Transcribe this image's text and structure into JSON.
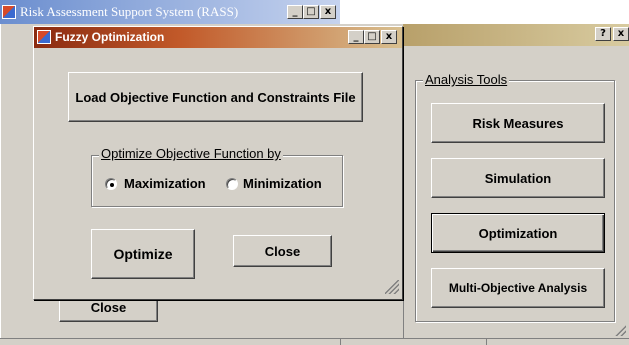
{
  "rass_window": {
    "title": "Risk Assessment Support System (RASS)",
    "minimize_glyph": "_",
    "maximize_glyph": "□",
    "close_glyph": "x",
    "help_glyph": "?",
    "analysis_tools": {
      "label": "Analysis Tools",
      "buttons": [
        "Risk Measures",
        "Simulation",
        "Optimization",
        "Multi-Objective Analysis"
      ]
    },
    "close_button": "Close"
  },
  "fuzzy_dialog": {
    "title": "Fuzzy Optimization",
    "load_button": "Load Objective Function and Constraints File",
    "optimize_group": {
      "label": "Optimize Objective Function by",
      "options": [
        "Maximization",
        "Minimization"
      ],
      "selected": "Maximization"
    },
    "optimize_button": "Optimize",
    "close_button": "Close"
  },
  "icons": {
    "app": "rass-app-icon",
    "grip": "resize-grip-icon"
  },
  "colors": {
    "face": "#d4d0c8",
    "back_title_active": "#6b8ecf",
    "dialog_title": "#c25a2a"
  }
}
